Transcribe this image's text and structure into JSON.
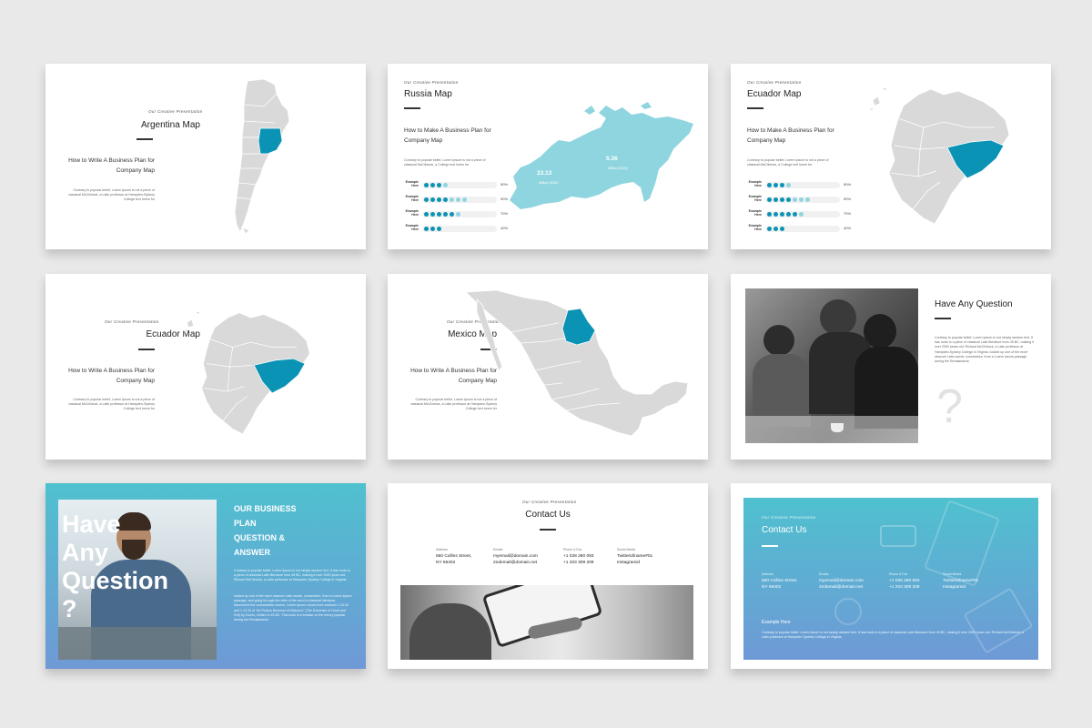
{
  "tagline": "Our Creative Presentation",
  "slides": {
    "argentina": {
      "title": "Argentina Map",
      "subtitle_l1": "How to Write A Business Plan for",
      "subtitle_l2": "Company Map",
      "body_l1": "Contrary to popular belief, Lorem Ipsum is not a piece of",
      "body_l2": "classical McClintock, a Latin professor at Hampden-Sydney",
      "body_l3": "College text lorem for"
    },
    "russia": {
      "title": "Russia Map",
      "subtitle_l1": "How to Make A Business Plan for",
      "subtitle_l2": "Company Map",
      "body_l1": "Contrary to popular belief, Lorem Ipsum is not a piece of",
      "body_l2": "classical McClintock, a College text lorem for",
      "stat1_value": "23.13",
      "stat1_label": "Million (2020)",
      "stat2_value": "5.36",
      "stat2_label": "Million (2020)"
    },
    "ecuador1": {
      "title": "Ecuador Map",
      "subtitle_l1": "How to Make A Business Plan for",
      "subtitle_l2": "Company Map",
      "body_l1": "Contrary to popular belief, Lorem Ipsum is not a piece of",
      "body_l2": "classical McClintock, a College text lorem for"
    },
    "ecuador2": {
      "title": "Ecuador Map",
      "subtitle_l1": "How to Write A Business Plan for",
      "subtitle_l2": "Company Map",
      "body_l1": "Contrary to popular belief, Lorem Ipsum is not a piece of",
      "body_l2": "classical McClintock, a Latin professor at Hampden-Sydney",
      "body_l3": "College text lorem for"
    },
    "mexico": {
      "title": "Mexico Map",
      "subtitle_l1": "How to Write A Business Plan for",
      "subtitle_l2": "Company Map",
      "body_l1": "Contrary to popular belief, Lorem Ipsum is not a piece of",
      "body_l2": "classical McClintock, a Latin professor at Hampden-Sydney",
      "body_l3": "College text lorem for"
    },
    "question": {
      "title": "Have Any Question",
      "body": "Contrary to popular belief, Lorem Ipsum is not simply random text. It has roots in a piece of classical Latin literature from 45 BC, making it over 2000 years old. Richard McClintock, a Latin professor at Hampden-Sydney College in Virginia, looked up one of the more obscure Latin words, consectetur, from a Lorem Ipsum passage during the Renaissance.",
      "mark": "?"
    },
    "qa": {
      "big_l1": "Have",
      "big_l2": "Any",
      "big_l3": "Question",
      "big_l4": "?",
      "heading_l1": "OUR BUSINESS",
      "heading_l2": "PLAN",
      "heading_l3": "QUESTION &",
      "heading_l4": "ANSWER",
      "body1": "Contrary to popular belief, Lorem Ipsum is not simply random text. It has roots in a piece of classical Latin literature from 45 BC, making it over 2000 years old. Richard McClintock, a Latin professor at Hampden-Sydney College in Virginia.",
      "body2": "looked up one of the more obscure Latin words, consectetur, from a Lorem Ipsum passage, and going through the cites of the word in classical literature, discovered the undoubtable source. Lorem Ipsum comes from sections 1.10.32 and 1.10.33 of \"de Finibus Bonorum et Malorum\" (The Extremes of Good and Evil) by Cicero, written in 45 BC. This book is a treatise on the theory popular during the Renaissance."
    },
    "contact": {
      "title": "Contact Us"
    },
    "contact2": {
      "title": "Contact Us",
      "example": "Example Here",
      "body": "Contrary to popular belief, Lorem Ipsum is not simply random text. It has roots in a piece of classical Latin literature from 45 BC, making it over 2000 years old. Richard McClintock, a Latin professor at Hampden-Sydney College in Virginia."
    }
  },
  "progress": {
    "rows": [
      {
        "label_l1": "Example",
        "label_l2": "Here",
        "filled": 3,
        "light": 1,
        "pct": "50%"
      },
      {
        "label_l1": "Example",
        "label_l2": "Here",
        "filled": 4,
        "light": 3,
        "pct": "90%"
      },
      {
        "label_l1": "Example",
        "label_l2": "Here",
        "filled": 5,
        "light": 1,
        "pct": "70%"
      },
      {
        "label_l1": "Example",
        "label_l2": "Here",
        "filled": 3,
        "light": 0,
        "pct": "40%"
      }
    ]
  },
  "contact": {
    "address_h": "Address",
    "address_l1": "560 Collins Street,",
    "address_l2": "NY 86402",
    "email_h": "Emails",
    "email_l1": "myemail@domain.com",
    "email_l2": "2ndemail@domain.net",
    "phone_h": "Phone & Fax",
    "phone_l1": "+1 028 280 093",
    "phone_l2": "+1 203 309 209",
    "social_h": "Social Media",
    "social_l1": "Twitterid/name#01",
    "social_l2": "Instagramid"
  },
  "colors": {
    "teal": "#0a93b5",
    "light_teal": "#8fd5df",
    "grad_top": "#4fc1cf",
    "grad_bottom": "#6f99d6"
  }
}
